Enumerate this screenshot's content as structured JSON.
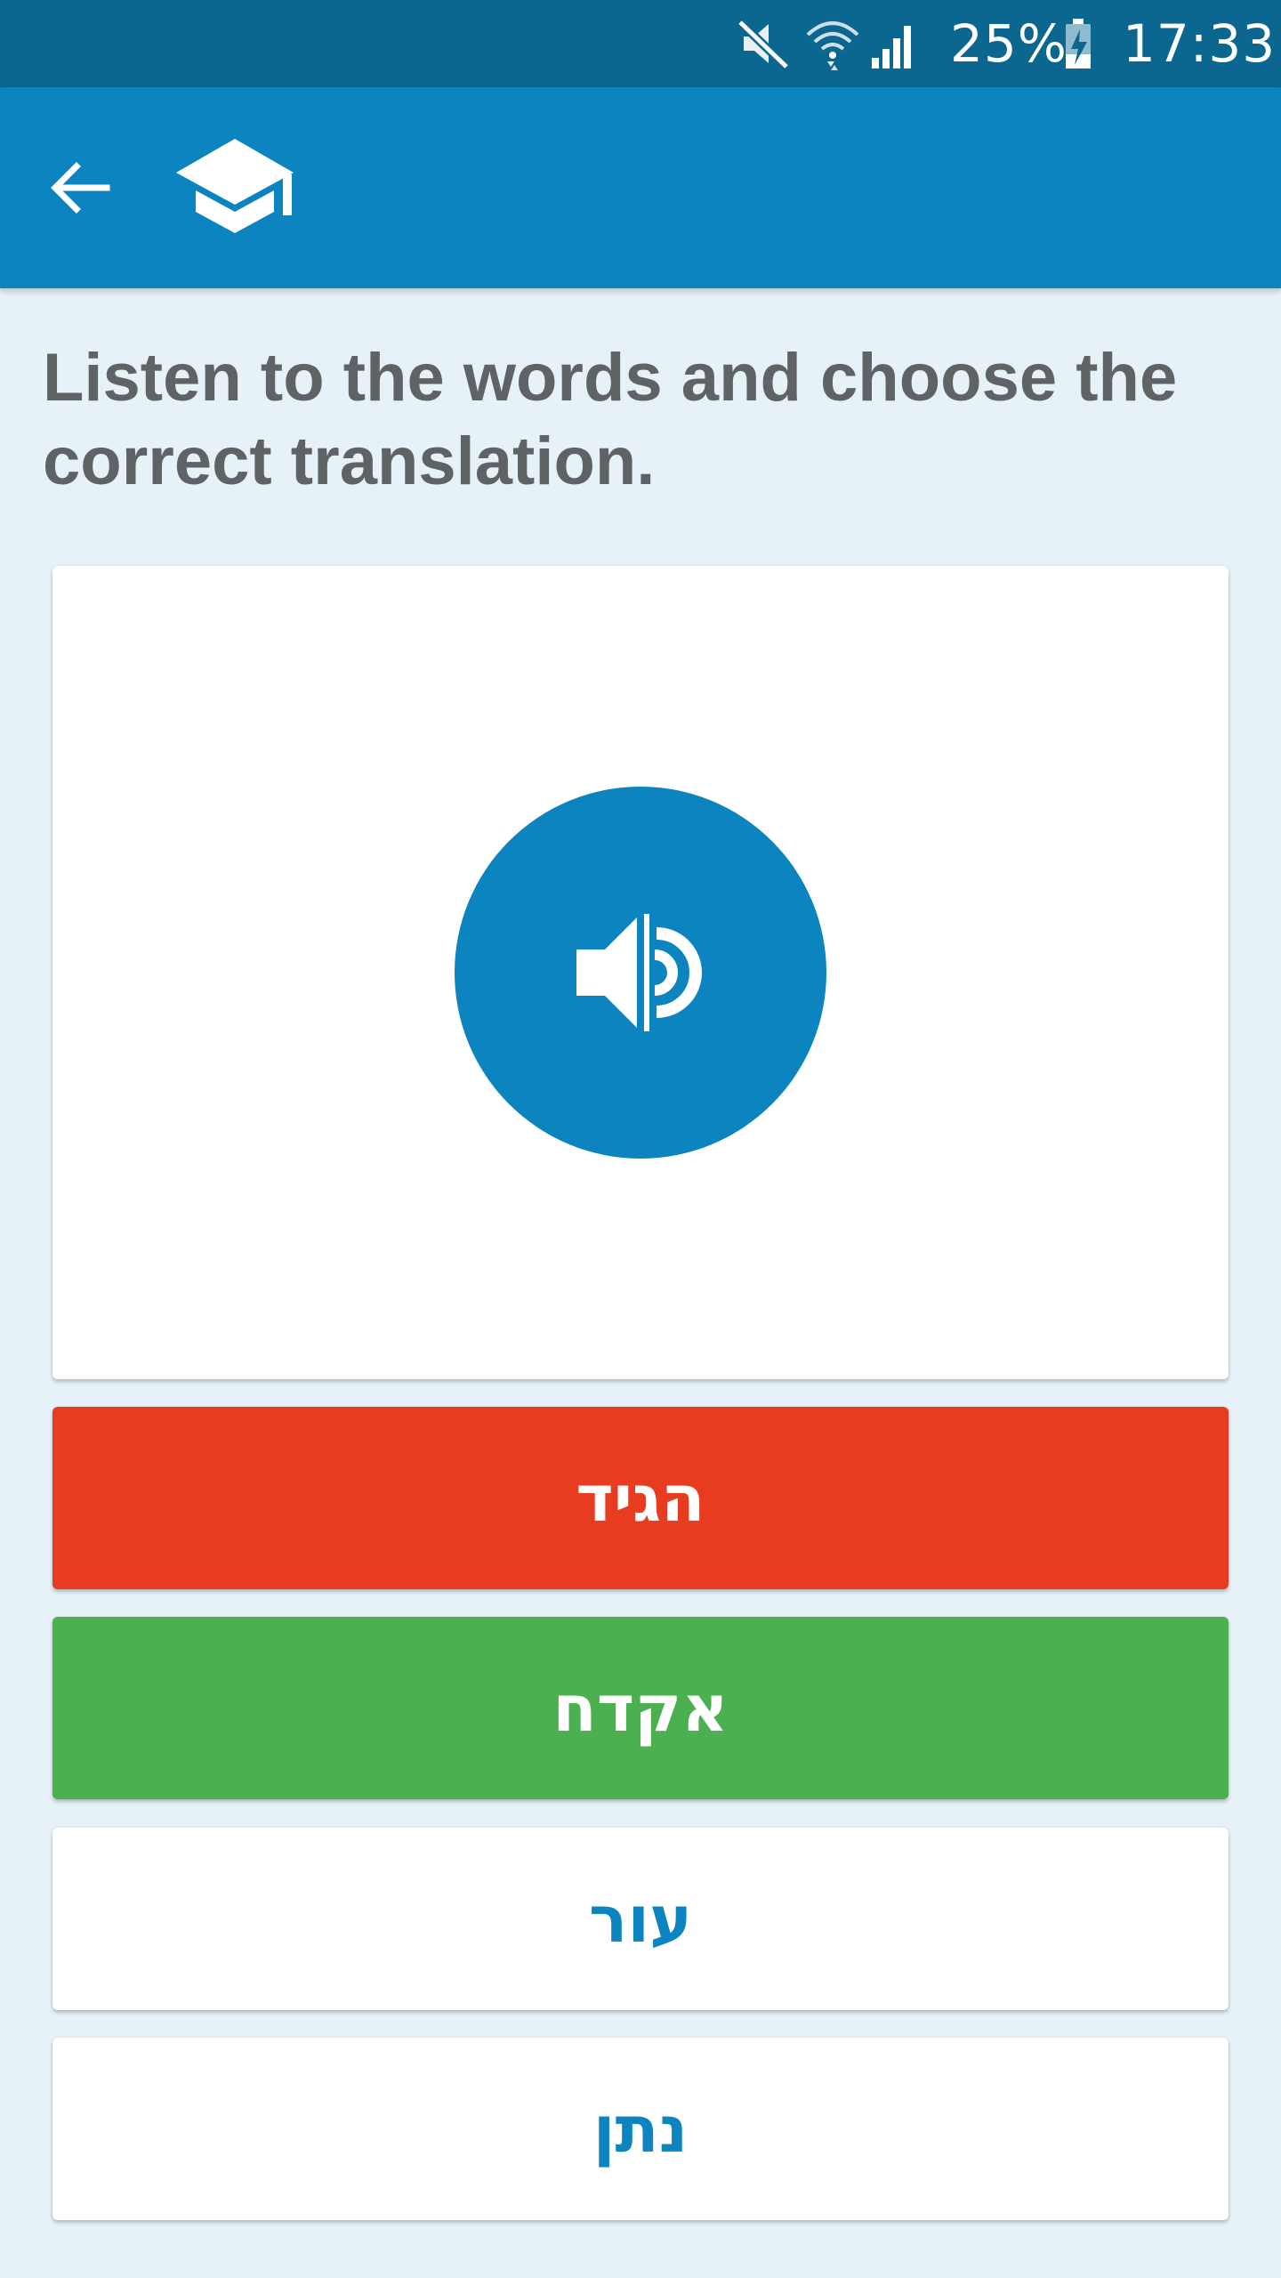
{
  "status_bar": {
    "battery_percent": "25%",
    "time": "17:33",
    "icons": [
      "mute-icon",
      "wifi-icon",
      "signal-icon",
      "battery-charging-icon"
    ]
  },
  "app_bar": {
    "icons": [
      "back-arrow-icon",
      "graduation-cap-icon"
    ]
  },
  "exercise": {
    "instruction": "Listen to the words and choose the correct translation.",
    "audio_icon": "speaker-icon"
  },
  "options": [
    {
      "label": "הגיד",
      "state": "wrong"
    },
    {
      "label": "אקדח",
      "state": "correct"
    },
    {
      "label": "עור",
      "state": "neutral"
    },
    {
      "label": "נתן",
      "state": "neutral"
    }
  ],
  "colors": {
    "status_bar": "#0b6690",
    "app_bar": "#0b84c0",
    "background": "#e6f2f8",
    "wrong": "#e83c20",
    "correct": "#4caf50",
    "accent": "#0b84c0"
  }
}
